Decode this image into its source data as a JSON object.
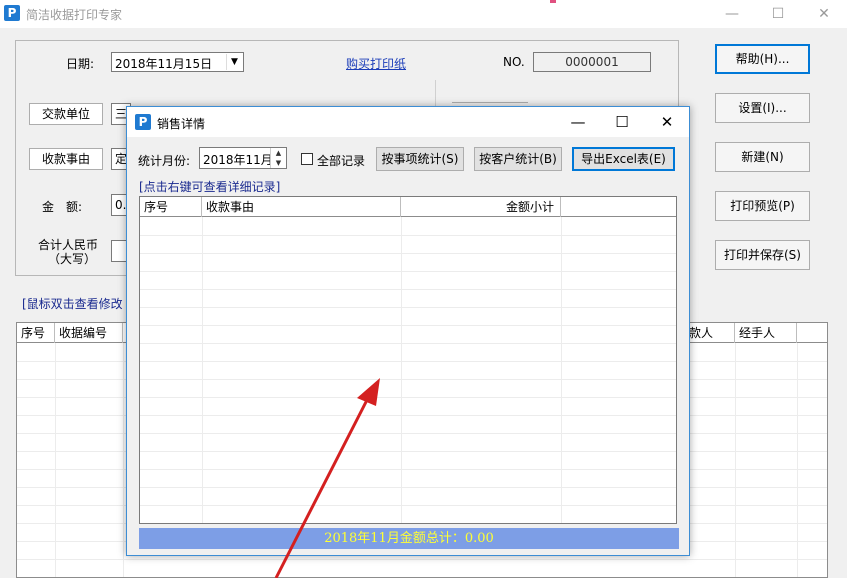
{
  "main_window": {
    "title": "简洁收据打印专家",
    "app_icon_letter": "P",
    "controls": {
      "minimize": "—",
      "maximize": "☐",
      "close": "✕"
    }
  },
  "form": {
    "date_label": "日期:",
    "date_value": "2018年11月15日",
    "buy_paper_link": "购买打印纸",
    "no_label": "NO.",
    "no_value": "0000001",
    "payer_button": "交款单位",
    "payer_value": "三",
    "reason_button": "收款事由",
    "reason_value": "定",
    "amount_label": "金　额:",
    "amount_value": "0.",
    "total_rmb_label_1": "合计人民币",
    "total_rmb_label_2": "（大写）"
  },
  "side_buttons": {
    "help": "帮助(H)...",
    "settings": "设置(I)...",
    "new": "新建(N)",
    "preview": "打印预览(P)",
    "print_save": "打印并保存(S)"
  },
  "main_hint": "[鼠标双击查看修改",
  "main_grid": {
    "columns": [
      "序号",
      "收据编号",
      "款人",
      "经手人"
    ]
  },
  "dialog": {
    "title": "销售详情",
    "icon_letter": "P",
    "controls": {
      "minimize": "—",
      "maximize": "☐",
      "close": "✕"
    },
    "month_label": "统计月份:",
    "month_value": "2018年11月",
    "all_records_label": "全部记录",
    "all_records_checked": false,
    "btn_by_item": "按事项统计(S)",
    "btn_by_customer": "按客户统计(B)",
    "btn_export": "导出Excel表(E)",
    "hint": "[点击右键可查看详细记录]",
    "columns": [
      "序号",
      "收款事由",
      "金额小计"
    ],
    "total_text": "2018年11月金额总计：0.00"
  },
  "colors": {
    "total_bar": "#7d9ee6",
    "total_text": "#ffff33",
    "link": "#1a3cb8",
    "hint": "#1a2a8f",
    "annotation_arrow": "#d42020"
  }
}
